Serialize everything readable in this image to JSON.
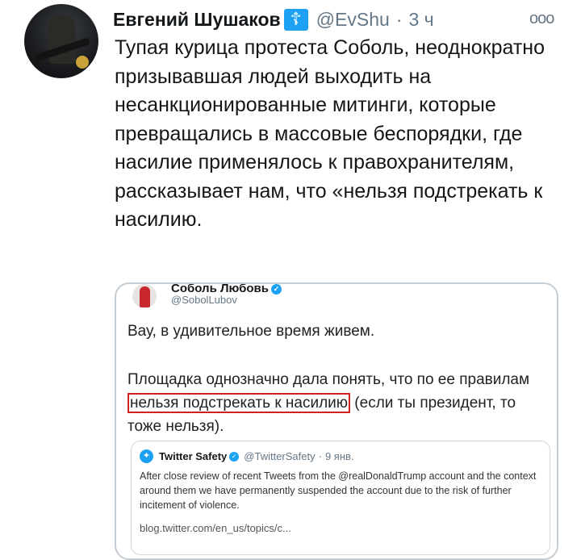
{
  "tweet": {
    "author_name": "Евгений Шушаков",
    "author_badge": "☦",
    "handle": "@EvShu",
    "separator": "·",
    "time": "3 ч",
    "more_icon": "more-icon",
    "text": "Тупая курица протеста Соболь, неоднократно призывавшая людей выходить на несанкционированные митинги, которые превращались в массовые беспорядки, где насилие применялось к правохранителям, рассказывает нам, что «нельзя подстрекать к насилию."
  },
  "screenshot": {
    "author_name": "Соболь Любовь",
    "handle": "@SobolLubov",
    "paragraph1": "Вау, в удивительное время живем.",
    "paragraph2_before": "Площадка однозначно дала понять, что по ее правилам ",
    "paragraph2_highlight": "нельзя подстрекать к насилию",
    "paragraph2_after": " (если ты президент, то тоже нельзя).",
    "highlight_color": "#d02020",
    "quote": {
      "author_name": "Twitter Safety",
      "handle": "@TwitterSafety",
      "separator": "·",
      "date": "9 янв.",
      "text": "After close review of recent Tweets from the @realDonaldTrump account and the context around them we have permanently suspended the account due to the risk of further incitement of violence.",
      "link": "blog.twitter.com/en_us/topics/c..."
    }
  },
  "colors": {
    "accent": "#1da1f2",
    "muted": "#657786",
    "text": "#14171a"
  }
}
